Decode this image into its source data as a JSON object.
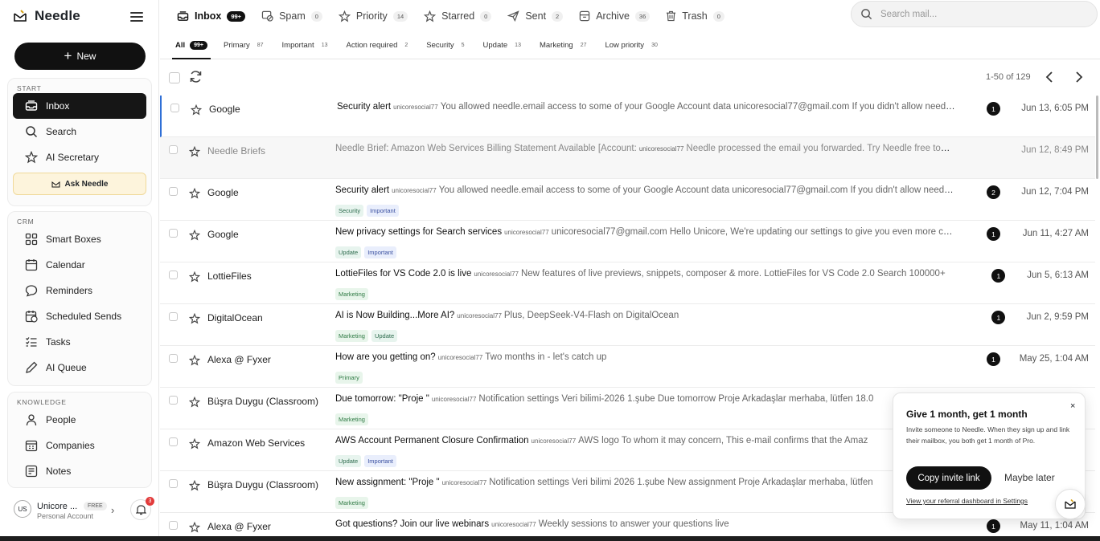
{
  "app": {
    "name": "Needle"
  },
  "sidebar": {
    "new_label": "New",
    "sections": [
      {
        "title": "START",
        "items": [
          {
            "label": "Inbox",
            "icon": "inbox-icon",
            "active": true
          },
          {
            "label": "Search",
            "icon": "search-icon"
          },
          {
            "label": "AI Secretary",
            "icon": "sparkle-star-icon"
          }
        ]
      },
      {
        "title": "CRM",
        "items": [
          {
            "label": "Smart Boxes",
            "icon": "grid-icon"
          },
          {
            "label": "Calendar",
            "icon": "calendar-icon"
          },
          {
            "label": "Reminders",
            "icon": "chat-bubble-icon"
          },
          {
            "label": "Scheduled Sends",
            "icon": "scheduled-calendar-icon"
          },
          {
            "label": "Tasks",
            "icon": "checklist-icon"
          },
          {
            "label": "AI Queue",
            "icon": "pencil-icon"
          }
        ]
      },
      {
        "title": "KNOWLEDGE",
        "items": [
          {
            "label": "People",
            "icon": "person-icon"
          },
          {
            "label": "Companies",
            "icon": "building-icon"
          },
          {
            "label": "Notes",
            "icon": "note-icon"
          }
        ]
      }
    ],
    "ask_needle_label": "Ask Needle",
    "user": {
      "initials": "US",
      "name": "Unicore ...",
      "plan": "FREE",
      "account": "Personal Account",
      "notifications": "3"
    }
  },
  "folders": [
    {
      "label": "Inbox",
      "count": "99+",
      "icon": "inbox-icon",
      "active": true
    },
    {
      "label": "Spam",
      "count": "0",
      "icon": "spam-icon"
    },
    {
      "label": "Priority",
      "count": "14",
      "icon": "star-icon"
    },
    {
      "label": "Starred",
      "count": "0",
      "icon": "star-icon"
    },
    {
      "label": "Sent",
      "count": "2",
      "icon": "send-icon"
    },
    {
      "label": "Archive",
      "count": "36",
      "icon": "archive-icon"
    },
    {
      "label": "Trash",
      "count": "0",
      "icon": "trash-icon"
    }
  ],
  "search": {
    "placeholder": "Search mail..."
  },
  "tabs": [
    {
      "label": "All",
      "count": "99+",
      "active": true
    },
    {
      "label": "Primary",
      "count": "87"
    },
    {
      "label": "Important",
      "count": "13"
    },
    {
      "label": "Action required",
      "count": "2"
    },
    {
      "label": "Security",
      "count": "5"
    },
    {
      "label": "Update",
      "count": "13"
    },
    {
      "label": "Marketing",
      "count": "27"
    },
    {
      "label": "Low priority",
      "count": "30"
    }
  ],
  "pagination": {
    "text": "1-50 of 129"
  },
  "emails": [
    {
      "sender": "Google",
      "subject": "Security alert",
      "account": "unicoresocial77",
      "snippet": "You allowed needle.email access to some of your Google Account data unicoresocial77@gmail.com If you didn't allow needle.email access",
      "tags": [],
      "count": "1",
      "date": "Jun 13, 6:05 PM",
      "selected": true
    },
    {
      "sender": "Needle Briefs",
      "subject": "Needle Brief: Amazon Web Services Billing Statement Available [Account:",
      "account": "unicoresocial77",
      "snippet": "Needle processed the email you forwarded. Try Needle free today",
      "tags": [],
      "count": "",
      "date": "Jun 12, 8:49 PM",
      "dim": true
    },
    {
      "sender": "Google",
      "subject": "Security alert",
      "account": "unicoresocial77",
      "snippet": "You allowed needle.email access to some of your Google Account data unicoresocial77@gmail.com If you didn't allow needle.email access",
      "tags": [
        "Security",
        "Important"
      ],
      "count": "2",
      "date": "Jun 12, 7:04 PM"
    },
    {
      "sender": "Google",
      "subject": "New privacy settings for Search services",
      "account": "unicoresocial77",
      "snippet": "unicoresocial77@gmail.com Hello Unicore, We're updating our settings to give you even more control",
      "tags": [
        "Update",
        "Important"
      ],
      "count": "1",
      "date": "Jun 11, 4:27 AM"
    },
    {
      "sender": "LottieFiles",
      "subject": "LottieFiles for VS Code 2.0 is live",
      "account": "unicoresocial77",
      "snippet": "New features of live previews, snippets, composer & more. LottieFiles for VS Code 2.0 Search 100000+",
      "tags": [
        "Marketing"
      ],
      "count": "1",
      "date": "Jun 5, 6:13 AM"
    },
    {
      "sender": "DigitalOcean",
      "subject": "AI is Now Building...More AI?",
      "account": "unicoresocial77",
      "snippet": "Plus, DeepSeek-V4-Flash on DigitalOcean",
      "tags": [
        "Marketing",
        "Update"
      ],
      "count": "1",
      "date": "Jun 2, 9:59 PM"
    },
    {
      "sender": "Alexa @ Fyxer",
      "subject": "How are you getting on?",
      "account": "unicoresocial77",
      "snippet": "Two months in - let's catch up",
      "tags": [
        "Primary"
      ],
      "count": "1",
      "date": "May 25, 1:04 AM"
    },
    {
      "sender": "Büşra Duygu (Classroom)",
      "subject": "Due tomorrow: \"Proje \"",
      "account": "unicoresocial77",
      "snippet": "Notification settings Veri bilimi-2026 1.şube Due tomorrow Proje Arkadaşlar merhaba, lütfen 18.0",
      "tags": [
        "Marketing"
      ],
      "count": "",
      "date": ""
    },
    {
      "sender": "Amazon Web Services",
      "subject": "AWS Account Permanent Closure Confirmation",
      "account": "unicoresocial77",
      "snippet": "AWS logo To whom it may concern, This e-mail confirms that the Amaz",
      "tags": [
        "Update",
        "Important"
      ],
      "count": "",
      "date": ""
    },
    {
      "sender": "Büşra Duygu (Classroom)",
      "subject": "New assignment: \"Proje \"",
      "account": "unicoresocial77",
      "snippet": "Notification settings Veri bilimi  2026 1.şube New assignment Proje Arkadaşlar merhaba, lütfen",
      "tags": [
        "Marketing"
      ],
      "count": "",
      "date": ""
    },
    {
      "sender": "Alexa @ Fyxer",
      "subject": "Got questions? Join our live webinars",
      "account": "unicoresocial77",
      "snippet": "Weekly sessions to answer your questions live",
      "tags": [],
      "count": "1",
      "date": "May 11, 1:04 AM"
    }
  ],
  "popup": {
    "title": "Give 1 month, get 1 month",
    "body": "Invite someone to Needle. When they sign up and link their mailbox, you both get 1 month of Pro.",
    "copy_label": "Copy invite link",
    "later_label": "Maybe later",
    "link_label": "View your referral dashboard in Settings",
    "close_label": "×"
  }
}
